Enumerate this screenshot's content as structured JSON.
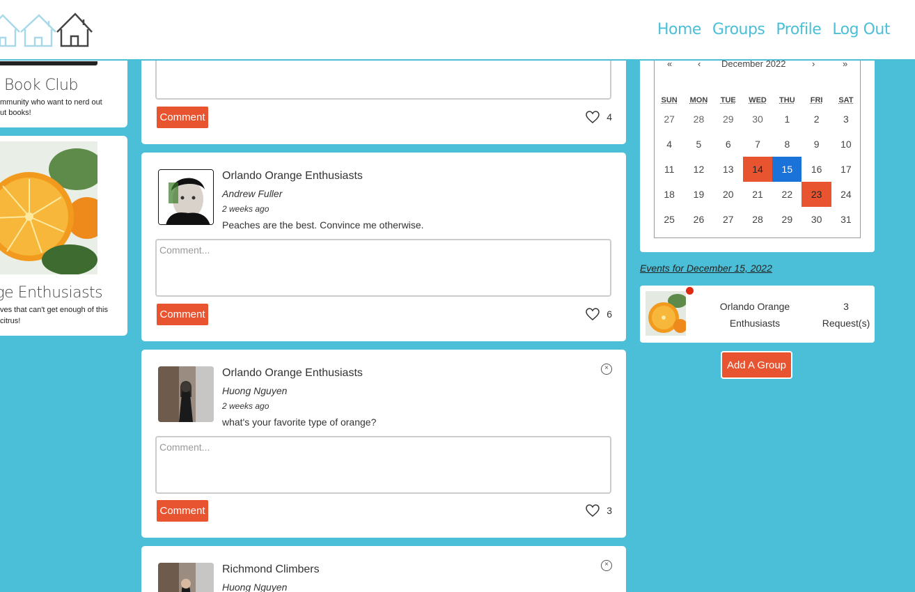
{
  "nav": {
    "home": "Home",
    "groups": "Groups",
    "profile": "Profile",
    "logout": "Log Out"
  },
  "groups": [
    {
      "name": "Book Club",
      "desc_line1": "mmunity who want to nerd out",
      "desc_line2": "ut books!"
    },
    {
      "name": "nge Enthusiasts",
      "desc_line1": "ves that can't get enough of this",
      "desc_line2": "citrus!"
    }
  ],
  "posts": [
    {
      "likes": "4"
    },
    {
      "group": "Orlando Orange Enthusiasts",
      "author": "Andrew Fuller",
      "time": "2 weeks ago",
      "body": "Peaches are the best. Convince me otherwise.",
      "likes": "6"
    },
    {
      "group": "Orlando Orange Enthusiasts",
      "author": "Huong Nguyen",
      "time": "2 weeks ago",
      "body": "what's your favorite type of orange?",
      "likes": "3"
    },
    {
      "group": "Richmond Climbers",
      "author": "Huong Nguyen"
    }
  ],
  "comment": {
    "placeholder": "Comment...",
    "button": "Comment"
  },
  "calendar": {
    "nav": {
      "prev2": "«",
      "prev": "‹",
      "month": "December 2022",
      "next": "›",
      "next2": "»"
    },
    "weekdays": [
      "SUN",
      "MON",
      "TUE",
      "WED",
      "THU",
      "FRI",
      "SAT"
    ],
    "weeks": [
      [
        "27",
        "28",
        "29",
        "30",
        "1",
        "2",
        "3"
      ],
      [
        "4",
        "5",
        "6",
        "7",
        "8",
        "9",
        "10"
      ],
      [
        "11",
        "12",
        "13",
        "14",
        "15",
        "16",
        "17"
      ],
      [
        "18",
        "19",
        "20",
        "21",
        "22",
        "23",
        "24"
      ],
      [
        "25",
        "26",
        "27",
        "28",
        "29",
        "30",
        "31"
      ]
    ],
    "event_days": [
      "14",
      "23"
    ],
    "selected_day": "15",
    "colors": {
      "event": "#e8542f",
      "selected": "#1a73d9"
    }
  },
  "events": {
    "heading": "Events for December 15, 2022",
    "items": [
      {
        "name": "Orlando Orange Enthusiasts",
        "requests": "3",
        "requests_label": "Request(s)"
      }
    ]
  },
  "add_group_label": "Add A Group",
  "colors": {
    "background": "#4bbfd7",
    "accent": "#e8542f",
    "nav": "#4bbfd7"
  }
}
